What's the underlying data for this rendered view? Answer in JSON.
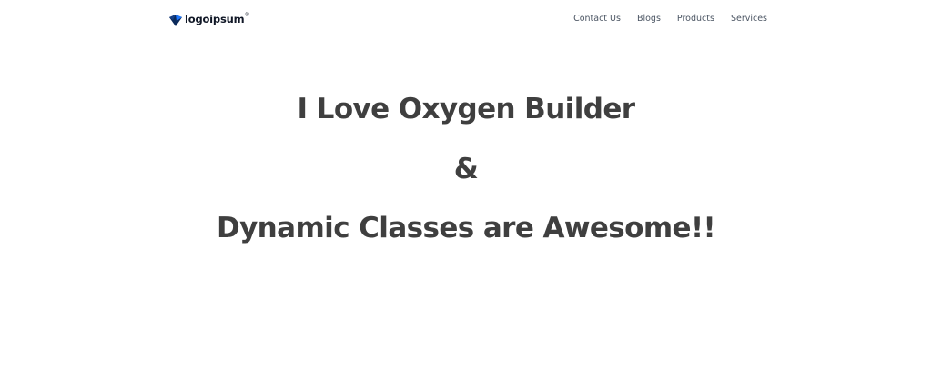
{
  "brand": {
    "logo_text": "logoipsum",
    "logo_mark": "®",
    "logo_icon": "logoipsum-diamond-icon",
    "logo_colors": [
      "#0b2a5b",
      "#1f78ff",
      "#111827"
    ]
  },
  "nav": {
    "items": [
      {
        "label": "Contact Us"
      },
      {
        "label": "Blogs"
      },
      {
        "label": "Products"
      },
      {
        "label": "Services"
      }
    ]
  },
  "hero": {
    "line1": "I Love Oxygen Builder",
    "line2": "&",
    "line3": "Dynamic Classes are Awesome!!"
  },
  "colors": {
    "background": "#ffffff",
    "heading": "#3f3f3f",
    "nav_text": "#4b5563"
  }
}
